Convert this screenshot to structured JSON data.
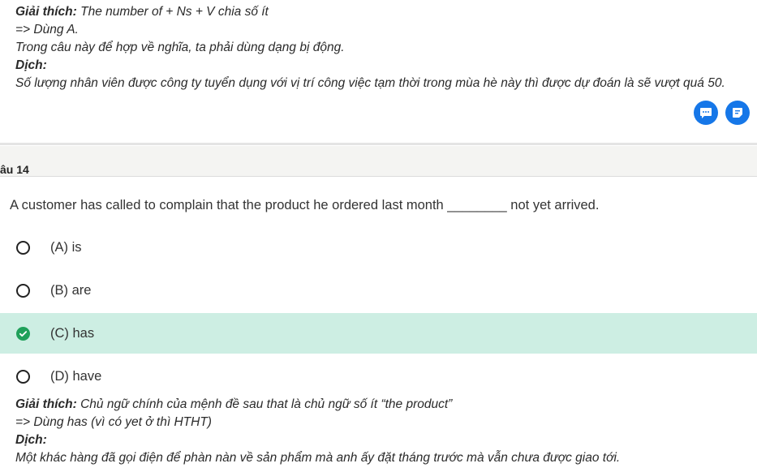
{
  "prev_explanation": {
    "label": "Giải thích:",
    "text": " The number of + Ns + V chia số ít",
    "line2": "=> Dùng A.",
    "line3": "Trong câu này để hợp về nghĩa, ta phải dùng dạng bị động.",
    "translate_label": "Dịch:",
    "translation": "Số lượng nhân viên được công ty tuyển dụng với vị trí công việc tạm thời trong mùa hè này thì được dự đoán là sẽ vượt quá 50."
  },
  "actions": {
    "chat_icon": "chat-bubble-icon",
    "note_icon": "note-icon",
    "color": "#1677e8"
  },
  "question": {
    "number_label": "âu 14",
    "text": "A customer has called to complain that the product he ordered last month ________ not yet arrived.",
    "options": [
      {
        "label": "(A) is",
        "selected": false
      },
      {
        "label": "(B) are",
        "selected": false
      },
      {
        "label": "(C) has",
        "selected": true
      },
      {
        "label": "(D) have",
        "selected": false
      }
    ],
    "correct_color": "#cdeee3",
    "check_color": "#20a05a"
  },
  "explanation": {
    "label": "Giải thích:",
    "text": " Chủ ngữ chính của mệnh đề sau that là chủ ngữ số ít “the product”",
    "line2": "=> Dùng has (vì có yet ở thì HTHT)",
    "translate_label": "Dịch:",
    "translation": "Một khác hàng đã gọi điện để phàn nàn về sản phẩm mà anh ấy đặt tháng trước mà vẫn chưa được giao tới."
  }
}
